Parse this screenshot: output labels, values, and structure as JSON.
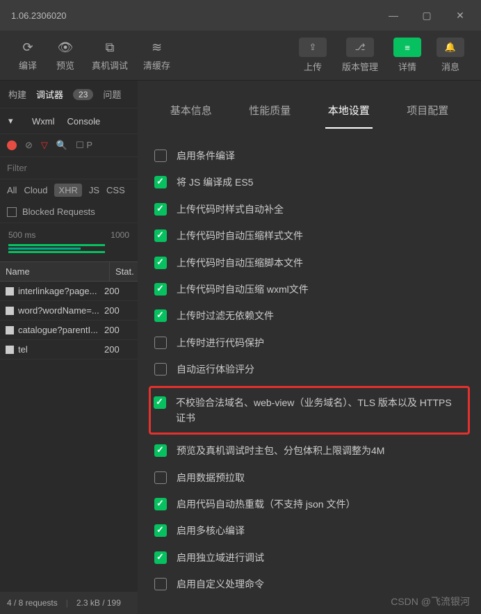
{
  "titlebar": {
    "version": "1.06.2306020"
  },
  "toolbar": {
    "left": {
      "compile": "编译",
      "preview": "预览",
      "debug": "真机调试",
      "cache": "清缓存"
    },
    "right": {
      "upload": "上传",
      "version": "版本管理",
      "details": "详情",
      "messages": "消息"
    }
  },
  "leftPane": {
    "tabs": {
      "build": "构建",
      "debugger": "调试器",
      "badge": "23",
      "issues": "问题"
    },
    "sub": {
      "wxml": "Wxml",
      "console": "Console"
    },
    "filter": "Filter",
    "types": {
      "all": "All",
      "cloud": "Cloud",
      "xhr": "XHR",
      "js": "JS",
      "css": "CSS"
    },
    "blocked": "Blocked Requests",
    "timeline": {
      "t1": "500 ms",
      "t2": "1000"
    },
    "table": {
      "name": "Name",
      "status": "Stat."
    },
    "requests": [
      {
        "name": "interlinkage?page...",
        "status": "200"
      },
      {
        "name": "word?wordName=...",
        "status": "200"
      },
      {
        "name": "catalogue?parentI...",
        "status": "200"
      },
      {
        "name": "tel",
        "status": "200"
      }
    ],
    "status": {
      "req": "4 / 8 requests",
      "size": "2.3 kB / 199"
    }
  },
  "settings": {
    "tabs": {
      "basic": "基本信息",
      "perf": "性能质量",
      "local": "本地设置",
      "project": "项目配置"
    },
    "options": [
      {
        "checked": false,
        "label": "启用条件编译"
      },
      {
        "checked": true,
        "label": "将 JS 编译成 ES5"
      },
      {
        "checked": true,
        "label": "上传代码时样式自动补全"
      },
      {
        "checked": true,
        "label": "上传代码时自动压缩样式文件"
      },
      {
        "checked": true,
        "label": "上传代码时自动压缩脚本文件"
      },
      {
        "checked": true,
        "label": "上传代码时自动压缩 wxml文件"
      },
      {
        "checked": true,
        "label": "上传时过滤无依赖文件"
      },
      {
        "checked": false,
        "label": "上传时进行代码保护"
      },
      {
        "checked": false,
        "label": "自动运行体验评分"
      },
      {
        "checked": true,
        "label": "不校验合法域名、web-view（业务域名）、TLS 版本以及 HTTPS 证书",
        "highlight": true
      },
      {
        "checked": true,
        "label": "预览及真机调试时主包、分包体积上限调整为4M"
      },
      {
        "checked": false,
        "label": "启用数据预拉取"
      },
      {
        "checked": true,
        "label": "启用代码自动热重载（不支持 json 文件）"
      },
      {
        "checked": true,
        "label": "启用多核心编译"
      },
      {
        "checked": true,
        "label": "启用独立域进行调试"
      },
      {
        "checked": false,
        "label": "启用自定义处理命令"
      }
    ]
  },
  "watermark": "CSDN @飞流银河"
}
